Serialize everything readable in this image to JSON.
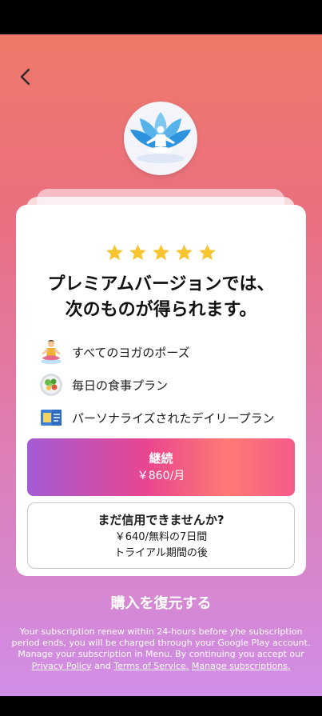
{
  "back_icon": "chevron-left-icon",
  "logo_icon": "lotus-yoga-icon",
  "rating_stars": 5,
  "headline_line1": "プレミアムバージョンでは、",
  "headline_line2": "次のものが得られます。",
  "features": [
    {
      "label": "すべてのヨガのポーズ",
      "icon": "yoga-pose-icon"
    },
    {
      "label": "毎日の食事プラン",
      "icon": "salad-bowl-icon"
    },
    {
      "label": "パーソナライズされたデイリープラン",
      "icon": "calendar-plan-icon"
    }
  ],
  "continue_button": {
    "title": "継続",
    "price": "￥860/月"
  },
  "trial_button": {
    "title": "まだ信用できませんか?",
    "line2": "￥640/無料の7日間",
    "line3": "トライアル期間の後"
  },
  "restore_label": "購入を復元する",
  "legal": {
    "text": "Your subscription renew within 24-hours before yhe subscription period ends, you will be charged through your Google Play account. Manage your subscription in Menu. By continuing you accept our",
    "privacy": "Privacy Policy",
    "and": "and",
    "terms": "Terms of Service.",
    "manage": "Manage subscriptions."
  },
  "colors": {
    "star": "#f8c531",
    "accent_start": "#a45bd6",
    "accent_mid": "#e9468f",
    "accent_end": "#ff7a74"
  }
}
